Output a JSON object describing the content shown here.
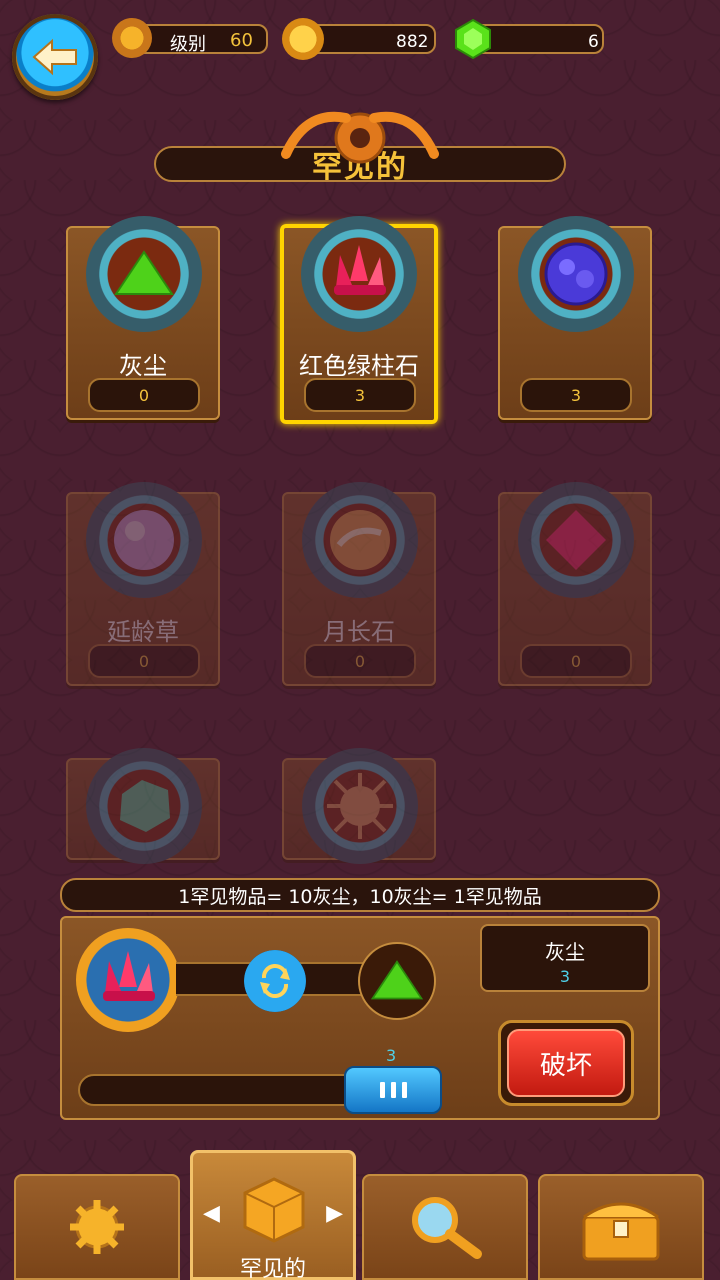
{
  "header": {
    "level_label": "级别",
    "level_value": "60",
    "coins": "882",
    "gems": "6"
  },
  "title": "罕见的",
  "cards": [
    {
      "name": "灰尘",
      "count": "0"
    },
    {
      "name": "红色绿柱石",
      "count": "3"
    },
    {
      "name": "",
      "count": "3"
    },
    {
      "name": "延龄草",
      "count": "0"
    },
    {
      "name": "月长石",
      "count": "0"
    },
    {
      "name": "",
      "count": "0"
    },
    {
      "name": "",
      "count": ""
    },
    {
      "name": "",
      "count": ""
    }
  ],
  "converter": {
    "rate_text": "1罕见物品= 10灰尘，10灰尘= 1罕见物品",
    "target_name": "灰尘",
    "target_count": "3",
    "slider_value": "3",
    "break_label": "破坏"
  },
  "nav": {
    "active_label": "罕见的"
  },
  "colors": {
    "accent_gold": "#f6c23a",
    "background": "#4a1f30",
    "button_red": "#e8291c",
    "slider_blue": "#1e9cf0"
  }
}
